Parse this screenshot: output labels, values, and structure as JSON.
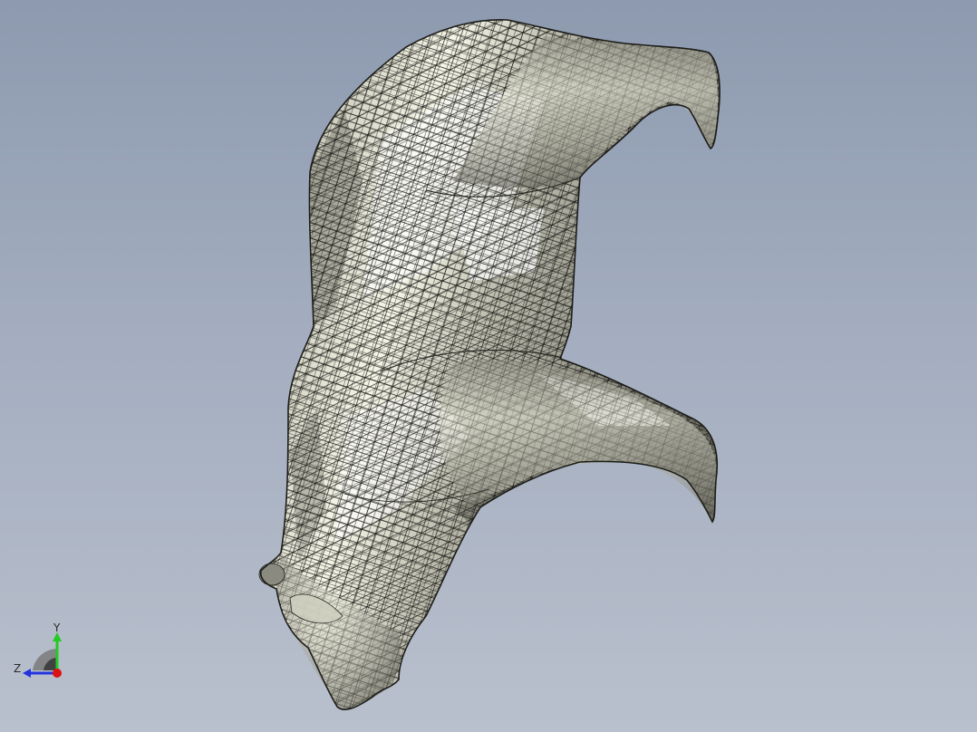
{
  "viewport": {
    "background_top": "#8d9aaf",
    "background_bottom": "#b9c0cd"
  },
  "model": {
    "shade_dark": "#5e5e54",
    "shade_mid": "#a9a99c",
    "shade_light": "#f4f4e4",
    "wire_color": "#1c1c18",
    "icon": "wireframe-mesh-icon"
  },
  "triad": {
    "y_label": "Y",
    "z_label": "Z",
    "y_color": "#22cc22",
    "z_color": "#2233dd",
    "x_color": "#dd1111"
  }
}
